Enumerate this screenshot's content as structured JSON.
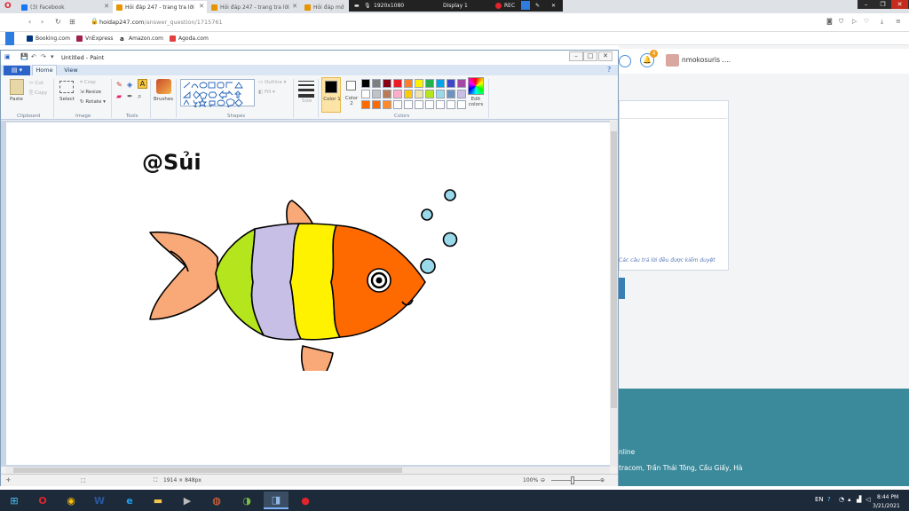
{
  "browser": {
    "tabs": [
      {
        "title": "(3) Facebook",
        "color": "#1877f2"
      },
      {
        "title": "Hỏi đáp 247 - trang tra lời",
        "color": "#e69500"
      },
      {
        "title": "Hỏi đáp 247 - trang tra lời",
        "color": "#e69500"
      },
      {
        "title": "Hỏi đáp mở",
        "color": "#e69500"
      }
    ],
    "url_domain": "hoidap247.com",
    "url_path": "/answer_question/1715761",
    "bookmarks": [
      {
        "label": "Booking.com",
        "color": "#003580"
      },
      {
        "label": "VnExpress",
        "color": "#9f224e"
      },
      {
        "label": "Amazon.com",
        "color": "#222222"
      },
      {
        "label": "Agoda.com",
        "color": "#e43f3f"
      }
    ]
  },
  "screen_recorder": {
    "resolution": "1920x1080",
    "display": "Display 1",
    "rec": "REC"
  },
  "paint": {
    "title": "Untitled - Paint",
    "file_label": "",
    "tabs": {
      "home": "Home",
      "view": "View"
    },
    "clipboard": {
      "paste": "Paste",
      "cut": "Cut",
      "copy": "Copy",
      "group": "Clipboard"
    },
    "image": {
      "select": "Select",
      "crop": "Crop",
      "resize": "Resize",
      "rotate": "Rotate",
      "group": "Image"
    },
    "tools": {
      "group": "Tools"
    },
    "brushes": "Brushes",
    "shapes": {
      "outline": "Outline",
      "fill": "Fill",
      "group": "Shapes"
    },
    "size": "Size",
    "color1": {
      "label": "Color 1",
      "value": "#000000"
    },
    "color2": {
      "label": "Color 2",
      "value": "#ffffff"
    },
    "edit_colors": "Edit colors",
    "colors_group": "Colors",
    "palette": [
      "#000000",
      "#7f7f7f",
      "#880015",
      "#ed1c24",
      "#ff7f27",
      "#fff200",
      "#22b14c",
      "#00a2e8",
      "#3f48cc",
      "#a349a4",
      "#ffffff",
      "#c3c3c3",
      "#b97a57",
      "#ffaec9",
      "#ffc90e",
      "#efe4b0",
      "#b5e61d",
      "#99d9ea",
      "#7092be",
      "#c8bfe7",
      "#ff6a00",
      "#ff6a00",
      "#ff8a2a",
      "#ffffff",
      "#ffffff",
      "#ffffff",
      "#ffffff",
      "#ffffff",
      "#ffffff",
      "#ffffff"
    ],
    "canvas_text": "@Sủi",
    "status_size": "1914 × 848px",
    "zoom": "100%"
  },
  "fish_colors": {
    "tail": "#f9a877",
    "stripe_green": "#b5e61d",
    "stripe_lavender": "#c8bfe7",
    "stripe_yellow": "#fff200",
    "head": "#ff6a00",
    "bubble": "#99d9ea"
  },
  "website": {
    "logo": "hoidap247",
    "notification_count": "4",
    "username": "nmokosuris ....",
    "pending_note": "Các câu trả lời đều được kiểm duyệt",
    "footer_online": "nline",
    "footer_address": "tracom, Trần Thái Tông, Cầu Giấy, Hà"
  },
  "taskbar": {
    "lang": "EN",
    "time": "8:44 PM",
    "date": "3/21/2021"
  }
}
